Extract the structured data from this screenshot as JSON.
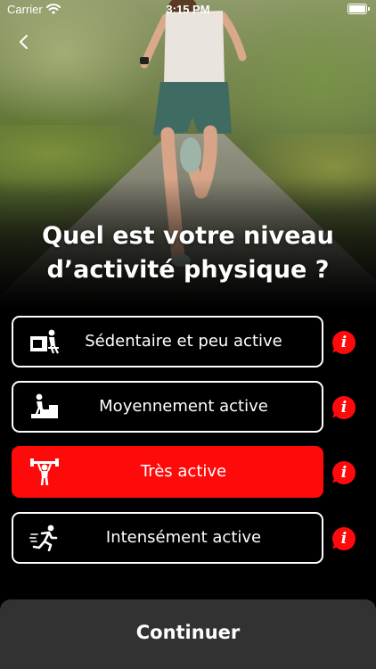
{
  "status_bar": {
    "carrier": "Carrier",
    "time": "3:15 PM",
    "wifi_icon": "wifi-icon",
    "battery_icon": "battery-full-icon"
  },
  "navigation": {
    "back_icon": "chevron-left-icon"
  },
  "hero": {
    "image": "woman-running-on-forest-road"
  },
  "question": {
    "line1": "Quel est votre niveau",
    "line2": "d’activité physique ?"
  },
  "options": [
    {
      "label": "Sédentaire et peu active",
      "icon": "desk-worker-icon",
      "selected": false,
      "info_icon": "info-icon"
    },
    {
      "label": "Moyennement active",
      "icon": "stairs-climber-icon",
      "selected": false,
      "info_icon": "info-icon"
    },
    {
      "label": "Très active",
      "icon": "weightlifter-icon",
      "selected": true,
      "info_icon": "info-icon"
    },
    {
      "label": "Intensément active",
      "icon": "sprinter-icon",
      "selected": false,
      "info_icon": "info-icon"
    }
  ],
  "continue_button": {
    "label": "Continuer"
  },
  "colors": {
    "accent": "#ff0a0a",
    "background": "#000000",
    "button_background": "#323232",
    "text": "#ffffff"
  }
}
